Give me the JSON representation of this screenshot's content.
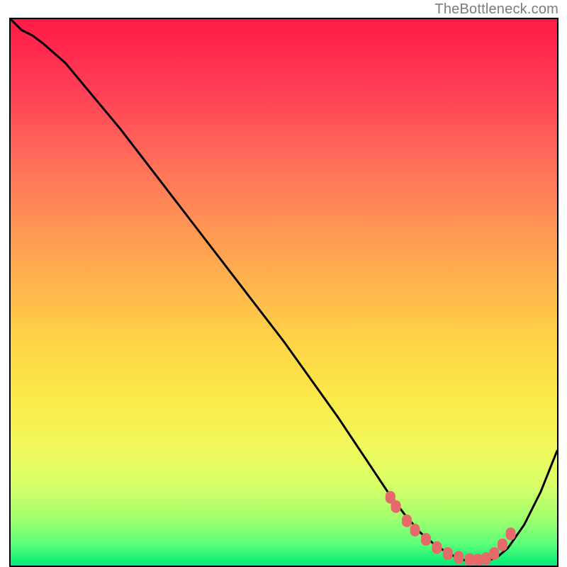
{
  "attribution": "TheBottleneck.com",
  "chart_data": {
    "type": "line",
    "title": "",
    "xlabel": "",
    "ylabel": "",
    "xlim": [
      0,
      100
    ],
    "ylim": [
      0,
      100
    ],
    "gradient_note": "background heatmap green (bottom) to red (top)",
    "series": [
      {
        "name": "curve",
        "color": "#000000",
        "x": [
          0,
          2,
          4,
          6,
          10,
          15,
          20,
          25,
          30,
          35,
          40,
          45,
          50,
          55,
          60,
          63,
          66,
          69,
          72,
          75,
          78,
          81,
          83,
          85,
          87,
          89,
          91,
          94,
          97,
          100
        ],
        "y": [
          100,
          98,
          97,
          95.5,
          92,
          86,
          80,
          73.5,
          67,
          60.5,
          54,
          47.5,
          41,
          34,
          27,
          22.5,
          18,
          13.5,
          9.5,
          6,
          3.5,
          1.8,
          1.0,
          0.7,
          0.8,
          1.5,
          3.2,
          7.5,
          13.5,
          21
        ]
      },
      {
        "name": "optimal-markers",
        "type": "scatter",
        "color": "#e66a6a",
        "x": [
          69.5,
          70.5,
          72.5,
          74,
          76,
          78,
          80,
          82,
          84,
          85.5,
          87,
          88.5,
          90,
          91.5
        ],
        "y": [
          12.5,
          10.8,
          8.2,
          6.5,
          4.8,
          3.3,
          2.2,
          1.5,
          1.1,
          1.0,
          1.3,
          2.2,
          3.8,
          5.8
        ]
      }
    ]
  }
}
